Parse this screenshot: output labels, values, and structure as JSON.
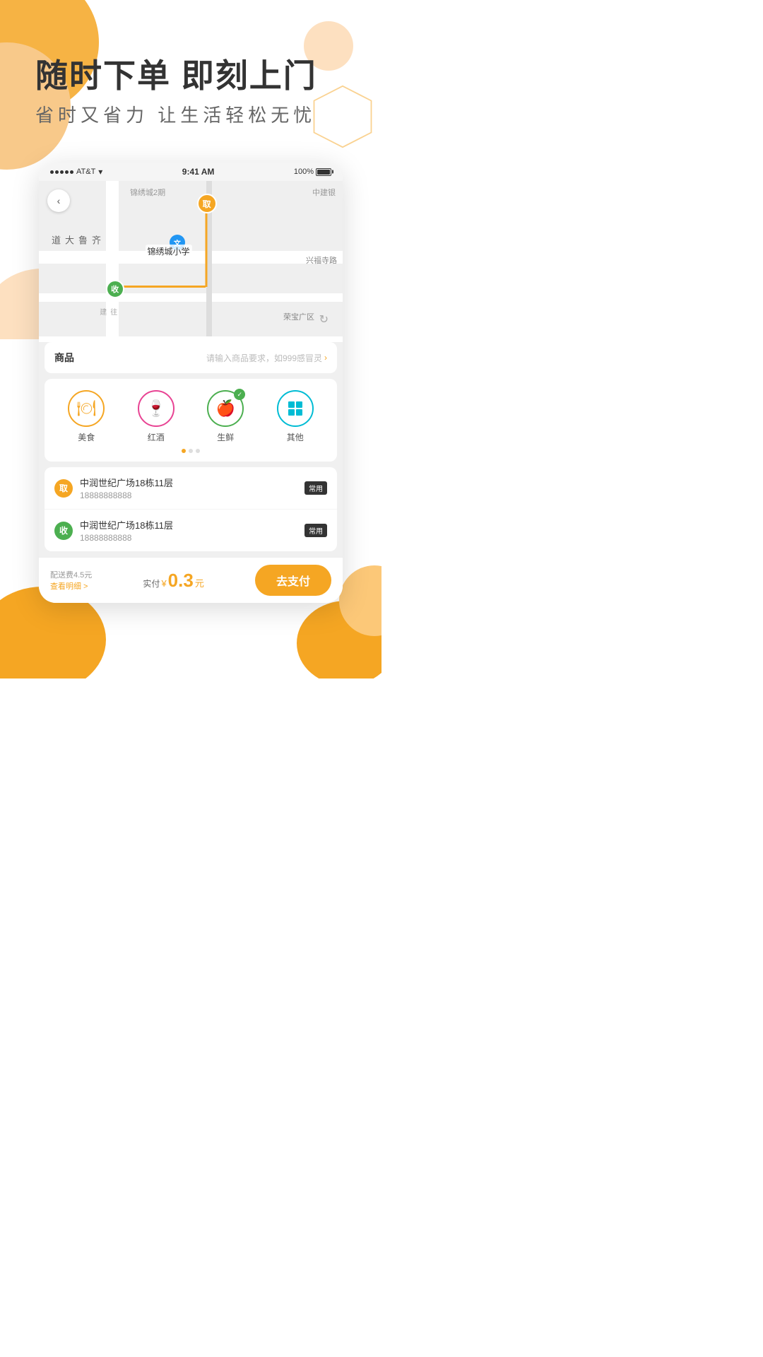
{
  "hero": {
    "title": "随时下单 即刻上门",
    "subtitle": "省时又省力    让生活轻松无忧"
  },
  "statusBar": {
    "carrier": "AT&T",
    "time": "9:41 AM",
    "battery": "100%"
  },
  "map": {
    "roads": {
      "qilu": "齐鲁大道",
      "jinxiucheng": "锦绣城2期",
      "zhongjian": "中建银",
      "xingfusi": "兴福寺路",
      "rongbao": "荣宝广区",
      "zaijian": "往建"
    },
    "school": "锦绣城小学",
    "pickupMarker": "取",
    "deliveryMarker": "收",
    "schoolMarker": "文"
  },
  "goods": {
    "label": "商品",
    "hint": "请输入商品要求，如999感冒灵"
  },
  "categories": [
    {
      "label": "美食",
      "icon": "🍽",
      "type": "food",
      "checked": false
    },
    {
      "label": "红酒",
      "icon": "🍷",
      "type": "wine",
      "checked": false
    },
    {
      "label": "生鲜",
      "icon": "🍎",
      "type": "fresh",
      "checked": true
    },
    {
      "label": "其他",
      "icon": "⊞",
      "type": "other",
      "checked": false
    }
  ],
  "addresses": [
    {
      "type": "pickup",
      "markerText": "取",
      "name": "中润世纪广场18栋11层",
      "phone": "18888888888",
      "tag": "常用"
    },
    {
      "type": "delivery",
      "markerText": "收",
      "name": "中润世纪广场18栋11层",
      "phone": "18888888888",
      "tag": "常用"
    }
  ],
  "bottomBar": {
    "deliveryFeeLabel": "配送费4.5元",
    "viewDetail": "查看明细 >",
    "actualPayLabel": "实付",
    "currencySymbol": "¥",
    "price": "0.3",
    "priceUnit": "元",
    "payButton": "去支付"
  }
}
